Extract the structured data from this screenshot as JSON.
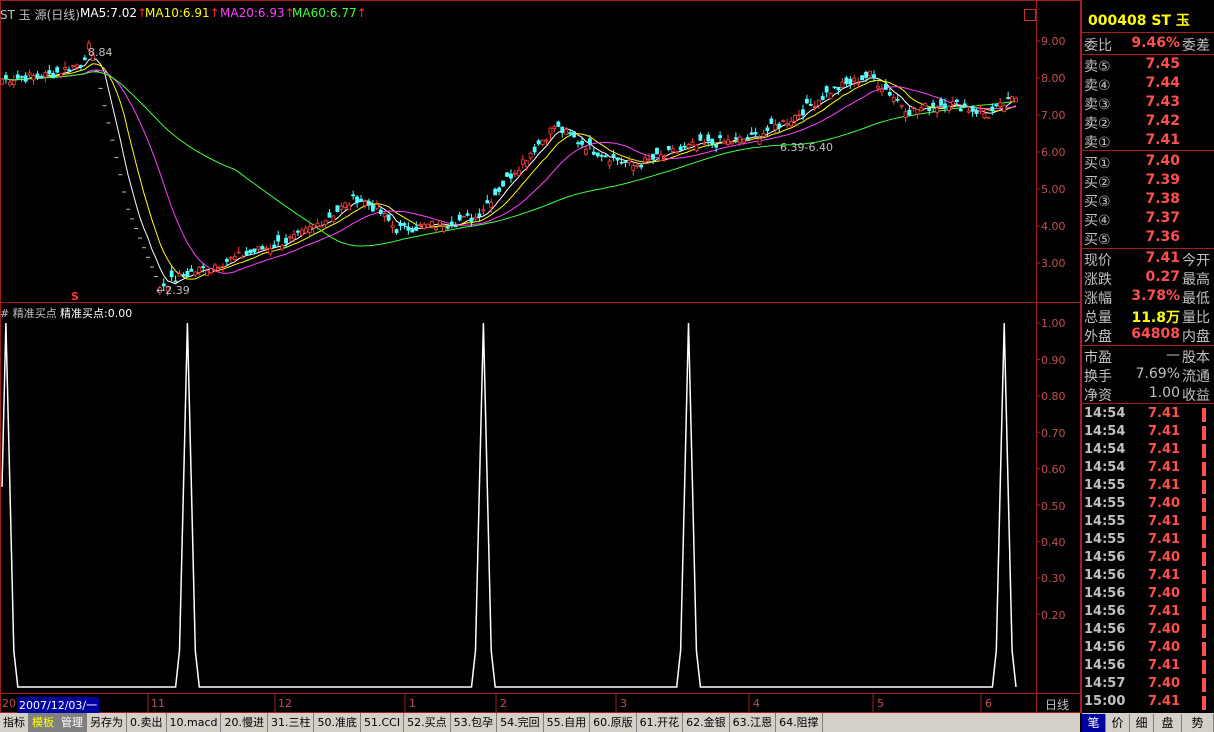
{
  "header": {
    "title": "ST 玉 源(日线)",
    "ma5": "MA5:7.02",
    "ma10": "MA10:6.91",
    "ma20": "MA20:6.93",
    "ma60": "MA60:6.77",
    "arrow": "↑",
    "ma5_color": "#ffffff",
    "ma10_color": "#ffff00",
    "ma20_color": "#ff40ff",
    "ma60_color": "#40ff40"
  },
  "annotations": {
    "high_label": "8.84",
    "low_label": "←2.39",
    "range_label": "6.39-6.40",
    "s_marker": "S"
  },
  "price_axis": [
    "9.00",
    "8.00",
    "7.00",
    "6.00",
    "5.00",
    "4.00",
    "3.00"
  ],
  "indicator": {
    "title": "# 精准买点",
    "value": "精准买点:0.00"
  },
  "indicator_axis": [
    "1.00",
    "0.90",
    "0.80",
    "0.70",
    "0.60",
    "0.50",
    "0.40",
    "0.30",
    "0.20"
  ],
  "date_bar": {
    "start": "20",
    "cursor_date": "2007/12/03/一",
    "months": [
      "11",
      "12",
      "1",
      "2",
      "3",
      "4",
      "5",
      "6"
    ],
    "period": "日线"
  },
  "tabs": [
    "指标",
    "模板",
    "管理",
    "另存为",
    "0.卖出",
    "10.macd",
    "20.慢进",
    "31.三柱",
    "50.准底",
    "51.CCI",
    "52.买点",
    "53.包孕",
    "54.完回",
    "55.自用",
    "60.原版",
    "61.开花",
    "62.金银",
    "63.江恩",
    "64.阻撑"
  ],
  "quote": {
    "code_name": "000408 ST 玉",
    "commission_ratio_label": "委比",
    "commission_ratio": "9.46%",
    "commission_diff_label": "委差",
    "asks": [
      {
        "label": "卖⑤",
        "price": "7.45"
      },
      {
        "label": "卖④",
        "price": "7.44"
      },
      {
        "label": "卖③",
        "price": "7.43"
      },
      {
        "label": "卖②",
        "price": "7.42"
      },
      {
        "label": "卖①",
        "price": "7.41"
      }
    ],
    "bids": [
      {
        "label": "买①",
        "price": "7.40"
      },
      {
        "label": "买②",
        "price": "7.39"
      },
      {
        "label": "买③",
        "price": "7.38"
      },
      {
        "label": "买④",
        "price": "7.37"
      },
      {
        "label": "买⑤",
        "price": "7.36"
      }
    ],
    "stats": [
      {
        "label": "现价",
        "value": "7.41",
        "right": "今开",
        "red": true
      },
      {
        "label": "涨跌",
        "value": "0.27",
        "right": "最高",
        "red": true
      },
      {
        "label": "涨幅",
        "value": "3.78%",
        "right": "最低",
        "red": true
      },
      {
        "label": "总量",
        "value": "11.8万",
        "right": "量比",
        "red": false
      },
      {
        "label": "外盘",
        "value": "64808",
        "right": "内盘",
        "red": true
      }
    ],
    "stats2": [
      {
        "label": "市盈",
        "value": "—",
        "right": "股本"
      },
      {
        "label": "换手",
        "value": "7.69%",
        "right": "流通"
      },
      {
        "label": "净资",
        "value": "1.00",
        "right": "收益"
      }
    ]
  },
  "ticks": [
    {
      "time": "14:54",
      "price": "7.41"
    },
    {
      "time": "14:54",
      "price": "7.41"
    },
    {
      "time": "14:54",
      "price": "7.41"
    },
    {
      "time": "14:54",
      "price": "7.41"
    },
    {
      "time": "14:55",
      "price": "7.41"
    },
    {
      "time": "14:55",
      "price": "7.40"
    },
    {
      "time": "14:55",
      "price": "7.41"
    },
    {
      "time": "14:55",
      "price": "7.41"
    },
    {
      "time": "14:56",
      "price": "7.40"
    },
    {
      "time": "14:56",
      "price": "7.41"
    },
    {
      "time": "14:56",
      "price": "7.40"
    },
    {
      "time": "14:56",
      "price": "7.41"
    },
    {
      "time": "14:56",
      "price": "7.40"
    },
    {
      "time": "14:56",
      "price": "7.40"
    },
    {
      "time": "14:56",
      "price": "7.41"
    },
    {
      "time": "14:57",
      "price": "7.40"
    },
    {
      "time": "15:00",
      "price": "7.41"
    }
  ],
  "bottom_tabs": [
    "笔",
    "价",
    "细",
    "盘",
    "势"
  ],
  "chart_data": {
    "type": "candlestick",
    "price_range": [
      2.2,
      9.6
    ],
    "indicator_range": [
      0,
      1
    ],
    "indicator_spikes_at": [
      1,
      47,
      122,
      174,
      254
    ],
    "indicator_count": 258
  }
}
